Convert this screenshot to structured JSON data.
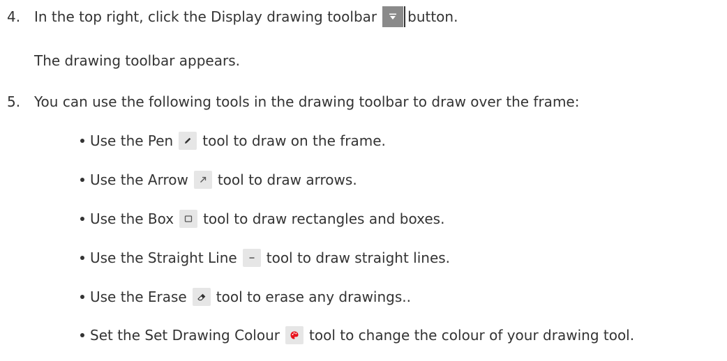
{
  "step4": {
    "number": "4.",
    "text_before": "In the top right, click the Display drawing toolbar",
    "text_after": "button.",
    "result": "The drawing toolbar appears."
  },
  "step5": {
    "number": "5.",
    "text": "You can use the following tools in the drawing toolbar to draw over the frame:"
  },
  "tools": [
    {
      "before": "Use the Pen",
      "after": "tool to draw on the frame.",
      "icon": "pen-icon"
    },
    {
      "before": "Use the Arrow",
      "after": "tool to draw arrows.",
      "icon": "arrow-icon"
    },
    {
      "before": "Use the Box",
      "after": "tool to draw rectangles and boxes.",
      "icon": "box-icon"
    },
    {
      "before": "Use the Straight Line",
      "after": "tool to draw straight lines.",
      "icon": "line-icon"
    },
    {
      "before": "Use the Erase",
      "after": "tool to erase any drawings..",
      "icon": "eraser-icon"
    },
    {
      "before": "Set the Set Drawing Colour",
      "after": "tool to change the colour of your drawing tool.",
      "icon": "palette-icon"
    }
  ],
  "colors": {
    "text": "#333333",
    "icon_bg": "#e6e6e6",
    "toolbar_button_bg": "#8a8a8a",
    "palette_red": "#e8121c"
  }
}
